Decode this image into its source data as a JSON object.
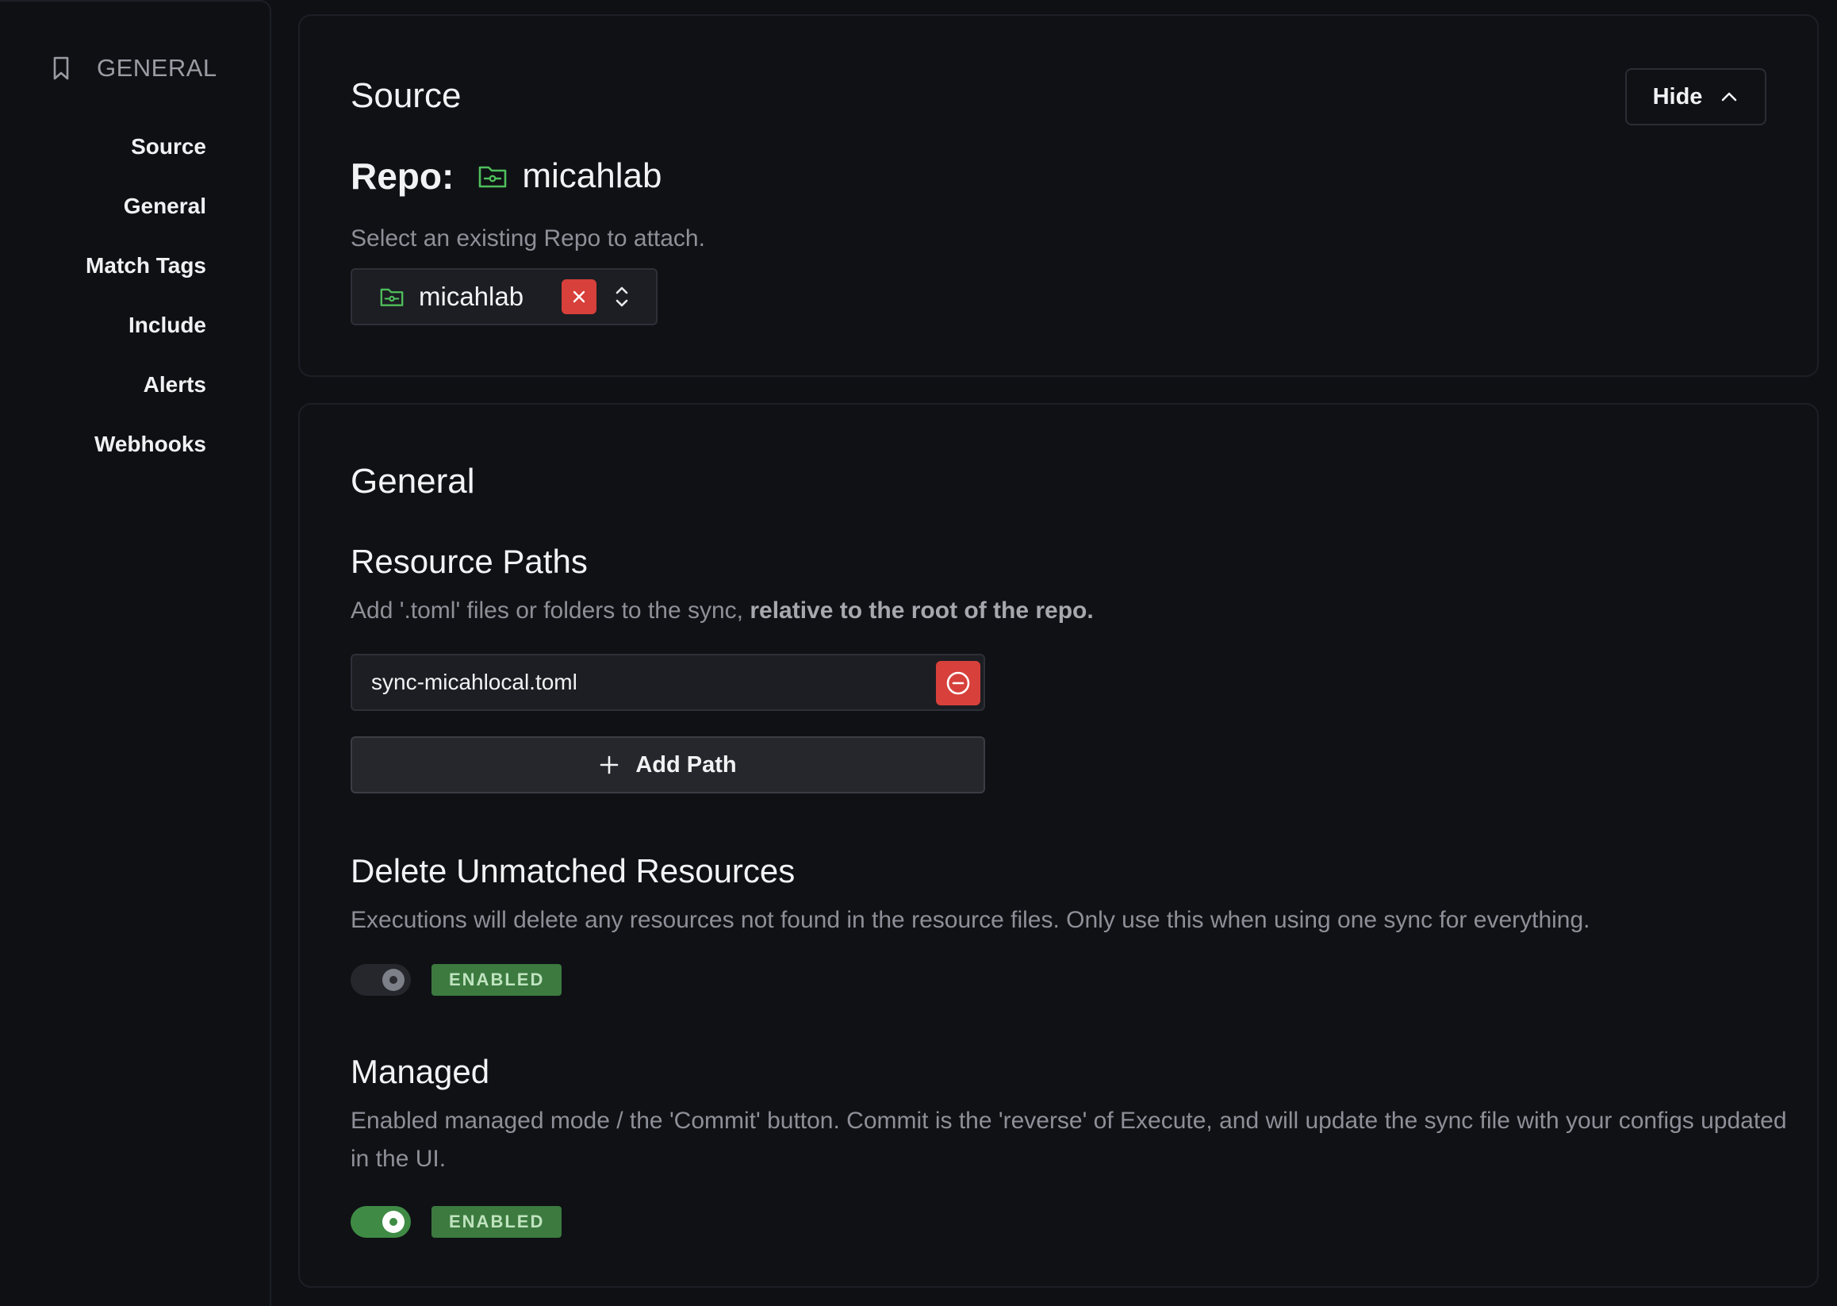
{
  "sidebar": {
    "header": "GENERAL",
    "items": [
      {
        "label": "Source"
      },
      {
        "label": "General"
      },
      {
        "label": "Match Tags"
      },
      {
        "label": "Include"
      },
      {
        "label": "Alerts"
      },
      {
        "label": "Webhooks"
      }
    ]
  },
  "source": {
    "title": "Source",
    "hide_label": "Hide",
    "repo_label": "Repo:",
    "repo_name": "micahlab",
    "description": "Select an existing Repo to attach.",
    "selected_repo": "micahlab"
  },
  "general": {
    "title": "General",
    "resource_paths": {
      "title": "Resource Paths",
      "description_prefix": "Add '.toml' files or folders to the sync, ",
      "description_bold": "relative to the root of the repo.",
      "paths": [
        "sync-micahlocal.toml"
      ],
      "add_label": "Add Path"
    },
    "delete_unmatched": {
      "title": "Delete Unmatched Resources",
      "description": "Executions will delete any resources not found in the resource files. Only use this when using one sync for everything.",
      "enabled": false,
      "badge": "ENABLED"
    },
    "managed": {
      "title": "Managed",
      "description": "Enabled managed mode / the 'Commit' button. Commit is the 'reverse' of Execute, and will update the sync file with your configs updated in the UI.",
      "enabled": true,
      "badge": "ENABLED"
    }
  },
  "colors": {
    "background": "#0e1014",
    "accent_green": "#3f8b45",
    "danger_red": "#d7403b"
  }
}
